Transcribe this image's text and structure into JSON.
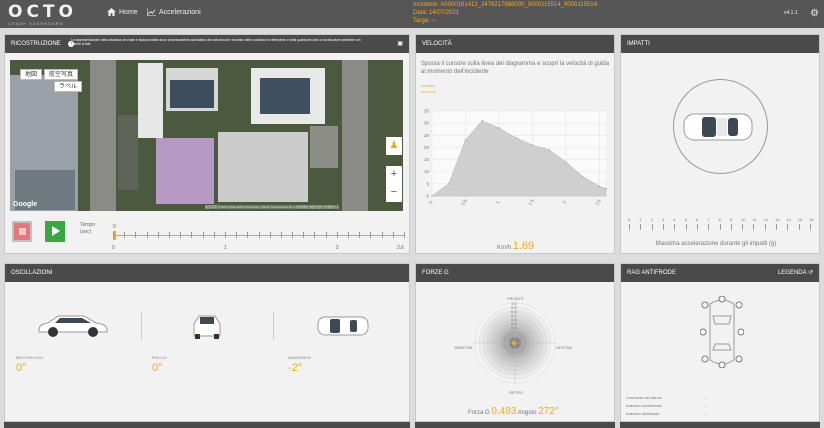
{
  "header": {
    "logo": "OCTO",
    "logo_sub": "CRASH DASHBOARD",
    "home_label": "Home",
    "accelerazioni_label": "Accelerazioni",
    "incidente": "Incidente: A0000161412_2476217988000_9000115514_9000115514",
    "data": "Data: 14/07/2021",
    "targa": "Targa: --",
    "version": "v4.1.1",
    "accent_color": "#f5a623"
  },
  "ricostruzione": {
    "title": "RICOSTRUZIONE",
    "info": "La rappresentazione della dinamica del crash è stata prodotta da un processamento automatico dei dati raccolti e secondo delle condizioni di riferimento e della qualità dei dati, la ricostruzione potrebbe non aderire ai fatti",
    "map_type_1": "地図",
    "map_type_2": "航空写真",
    "map_labels": "ラベル",
    "google": "Google",
    "attribution": "航空写真 ©2021 Digital Earth Technology, Maxar Technologies 10 m 利用規約 地図の誤りを報告する",
    "tempo_label": "Tempo",
    "sec_label": "(sec)",
    "time_current": "0",
    "time_ticks": [
      "0",
      "1",
      "2",
      "2.6"
    ],
    "time_max": 2.6
  },
  "velocita": {
    "title": "VELOCITÀ",
    "note": "Sposta il cursore sulla linea del diagramma e scopri la velocità di guida al momento dell'incidente",
    "legend_1": "velocità",
    "legend_2": "distanza",
    "kmh_label": "Km/h",
    "kmh_value": "1.69"
  },
  "chart_data": {
    "type": "area",
    "x": [
      0,
      0.25,
      0.5,
      0.75,
      1.0,
      1.25,
      1.5,
      1.75,
      2.0,
      2.25,
      2.5,
      2.6
    ],
    "values": [
      0,
      5,
      23,
      31,
      28,
      24,
      21,
      19,
      14,
      8,
      4,
      3
    ],
    "x_ticks": [
      "0",
      "0.5",
      "1",
      "1.5",
      "2",
      "2.5"
    ],
    "y_ticks": [
      "0",
      "5",
      "10",
      "15",
      "20",
      "25",
      "30",
      "35"
    ],
    "ylim": [
      0,
      35
    ],
    "xlim": [
      0,
      2.6
    ],
    "fill_color": "#cfcfcf",
    "grid": true
  },
  "impatti": {
    "title": "IMPATTI",
    "scale": [
      "0",
      "1",
      "2",
      "3",
      "4",
      "5",
      "6",
      "7",
      "8",
      "9",
      "10",
      "11",
      "12",
      "13",
      "14",
      "15",
      "16"
    ],
    "caption": "Massima accelerazione durante gli impatti (g)"
  },
  "oscillazioni": {
    "title": "OSCILLAZIONI",
    "beccheggio_label": "BECCHEGGIO",
    "beccheggio_value": "0°",
    "rollio_label": "ROLLIO",
    "rollio_value": "0°",
    "imbardata_label": "IMBARDATA",
    "imbardata_value": "-2°"
  },
  "forze": {
    "title": "FORZE G",
    "fronte": "FRONTE",
    "retro": "RETRO",
    "sinistra": "SINISTRA",
    "destra": "DESTRA",
    "rings": [
      "1.0",
      "0.9",
      "0.8",
      "0.7",
      "0.6",
      "0.5",
      "0.4"
    ],
    "forza_label": "Forza G",
    "forza_value": "0.493",
    "angolo_label": "Angolo",
    "angolo_value": "272°"
  },
  "rag": {
    "title": "RAG ANTIFRODE",
    "legenda": "LEGENDA",
    "rows": [
      {
        "label": "Coerenza del danno",
        "value": "--"
      },
      {
        "label": "Indirizzo confermato",
        "value": "--"
      },
      {
        "label": "Indirizzo dichiarato",
        "value": "--"
      }
    ]
  }
}
